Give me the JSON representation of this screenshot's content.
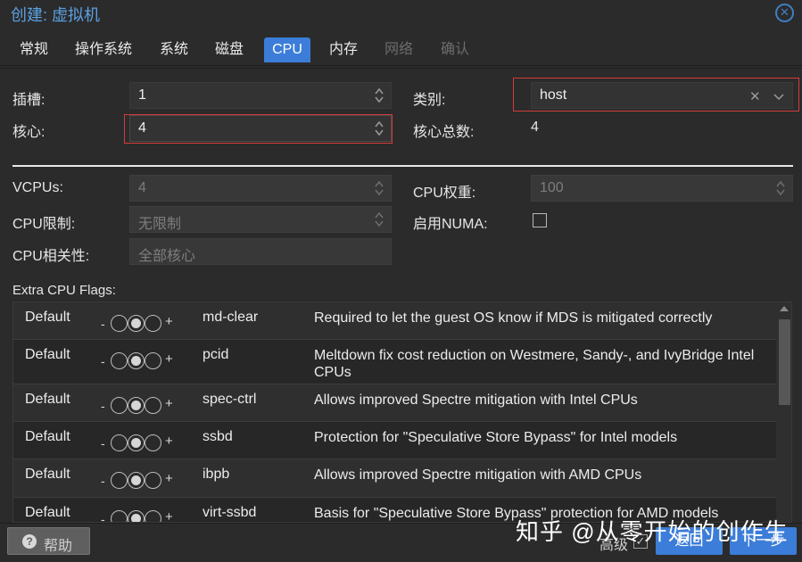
{
  "window": {
    "title": "创建: 虚拟机",
    "close_symbol": "✕"
  },
  "tabs": [
    {
      "label": "常规",
      "state": "normal"
    },
    {
      "label": "操作系统",
      "state": "normal"
    },
    {
      "label": "系统",
      "state": "normal"
    },
    {
      "label": "磁盘",
      "state": "normal"
    },
    {
      "label": "CPU",
      "state": "active"
    },
    {
      "label": "内存",
      "state": "normal"
    },
    {
      "label": "网络",
      "state": "disabled"
    },
    {
      "label": "确认",
      "state": "disabled"
    }
  ],
  "cpu": {
    "sockets": {
      "label": "插槽:",
      "value": "1"
    },
    "cores": {
      "label": "核心:",
      "value": "4"
    },
    "type": {
      "label": "类别:",
      "value": "host",
      "clear_symbol": "✕"
    },
    "total_cores": {
      "label": "核心总数:",
      "value": "4"
    },
    "vcpus": {
      "label": "VCPUs:",
      "value": "4"
    },
    "cpu_limit": {
      "label": "CPU限制:",
      "placeholder": "无限制"
    },
    "cpu_affinity": {
      "label": "CPU相关性:",
      "placeholder": "全部核心"
    },
    "cpu_units": {
      "label": "CPU权重:",
      "placeholder": "100"
    },
    "numa": {
      "label": "启用NUMA:",
      "checked": false
    }
  },
  "extra_flags": {
    "label": "Extra CPU Flags:",
    "rows": [
      {
        "state": "Default",
        "minus": "-",
        "plus": "+",
        "flag": "md-clear",
        "desc": "Required to let the guest OS know if MDS is mitigated correctly"
      },
      {
        "state": "Default",
        "minus": "-",
        "plus": "+",
        "flag": "pcid",
        "desc": "Meltdown fix cost reduction on Westmere, Sandy-, and IvyBridge Intel CPUs"
      },
      {
        "state": "Default",
        "minus": "-",
        "plus": "+",
        "flag": "spec-ctrl",
        "desc": "Allows improved Spectre mitigation with Intel CPUs"
      },
      {
        "state": "Default",
        "minus": "-",
        "plus": "+",
        "flag": "ssbd",
        "desc": "Protection for \"Speculative Store Bypass\" for Intel models"
      },
      {
        "state": "Default",
        "minus": "-",
        "plus": "+",
        "flag": "ibpb",
        "desc": "Allows improved Spectre mitigation with AMD CPUs"
      },
      {
        "state": "Default",
        "minus": "-",
        "plus": "+",
        "flag": "virt-ssbd",
        "desc": "Basis for \"Speculative Store Bypass\" protection for AMD models"
      }
    ]
  },
  "footer": {
    "help_icon": "?",
    "help_label": "帮助",
    "advanced_label": "高级",
    "advanced_checked": true,
    "advanced_check_symbol": "✓",
    "back_label": "返回",
    "next_label": "下一步"
  },
  "watermark": "知乎 @从零开始的创作生",
  "colors": {
    "accent": "#3b7dd8",
    "title": "#5aa1e3",
    "highlight": "#d63a3a"
  }
}
